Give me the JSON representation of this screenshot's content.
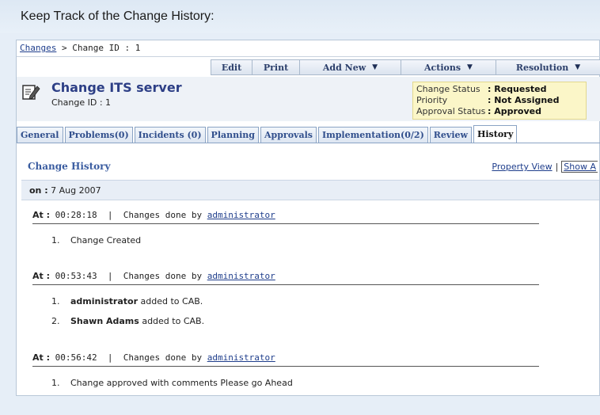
{
  "page": {
    "heading": "Keep Track of the Change History:"
  },
  "breadcrumb": {
    "root": "Changes",
    "separator": ">",
    "current": "Change ID : 1"
  },
  "toolbar": {
    "edit": "Edit",
    "print": "Print",
    "add_new": "Add New",
    "actions": "Actions",
    "resolution": "Resolution",
    "dropdown_glyph": "▼"
  },
  "change": {
    "title": "Change ITS server",
    "id_label": "Change ID : 1",
    "icon": "edit-document-icon"
  },
  "status": {
    "change_status_label": "Change Status",
    "change_status_value": ": Requested",
    "priority_label": "Priority",
    "priority_value": ": Not Assigned",
    "approval_label": "Approval Status",
    "approval_value": ": Approved"
  },
  "tabs": [
    {
      "label": "General"
    },
    {
      "label": "Problems(0)"
    },
    {
      "label": "Incidents (0)"
    },
    {
      "label": "Planning"
    },
    {
      "label": "Approvals"
    },
    {
      "label": "Implementation(0/2)"
    },
    {
      "label": "Review"
    },
    {
      "label": "History"
    }
  ],
  "history": {
    "heading": "Change History",
    "property_view": "Property View",
    "show_all": "Show A",
    "date_label": "on :",
    "date": "7 Aug 2007",
    "entries": [
      {
        "at_label": "At :",
        "time": "00:28:18",
        "by_text": "Changes done by",
        "user": "administrator",
        "items": [
          {
            "num": "1.",
            "text": "Change Created"
          }
        ]
      },
      {
        "at_label": "At :",
        "time": "00:53:43",
        "by_text": "Changes done by",
        "user": "administrator",
        "items": [
          {
            "num": "1.",
            "bold": "administrator",
            "text": " added to CAB."
          },
          {
            "num": "2.",
            "bold": "Shawn Adams",
            "text": " added to CAB."
          }
        ]
      },
      {
        "at_label": "At :",
        "time": "00:56:42",
        "by_text": "Changes done by",
        "user": "administrator",
        "items": [
          {
            "num": "1.",
            "text": "Change approved with comments Please go Ahead"
          }
        ]
      }
    ]
  },
  "colors": {
    "accent": "#2d3f86",
    "status_bg": "#fbf6c8",
    "panel_bg": "#ffffff",
    "page_bg": "#e6eef7"
  }
}
